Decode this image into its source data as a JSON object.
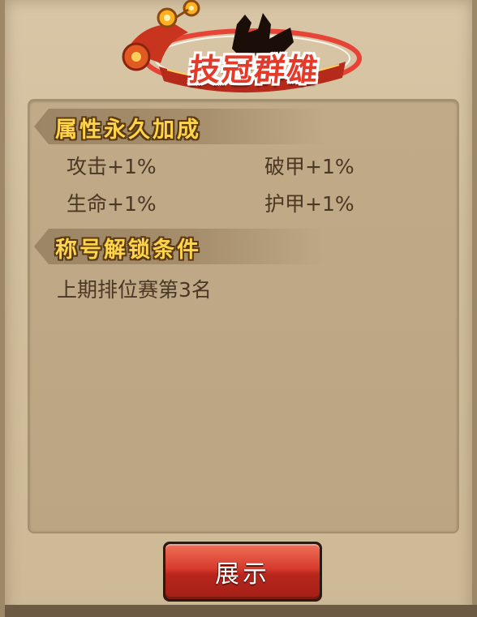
{
  "title": {
    "badge_text": "技冠群雄"
  },
  "sections": {
    "attributes": {
      "header": "属性永久加成",
      "items": [
        "攻击+1%",
        "破甲+1%",
        "生命+1%",
        "护甲+1%"
      ]
    },
    "unlock": {
      "header": "称号解锁条件",
      "condition": "上期排位赛第3名"
    }
  },
  "actions": {
    "show_label": "展示"
  },
  "colors": {
    "title_red": "#e43a2a",
    "header_gold": "#ffd44a",
    "button_red": "#d63a2c",
    "text_brown": "#4a3724"
  },
  "icons": {
    "emblem": "trophy-emblem-icon"
  }
}
